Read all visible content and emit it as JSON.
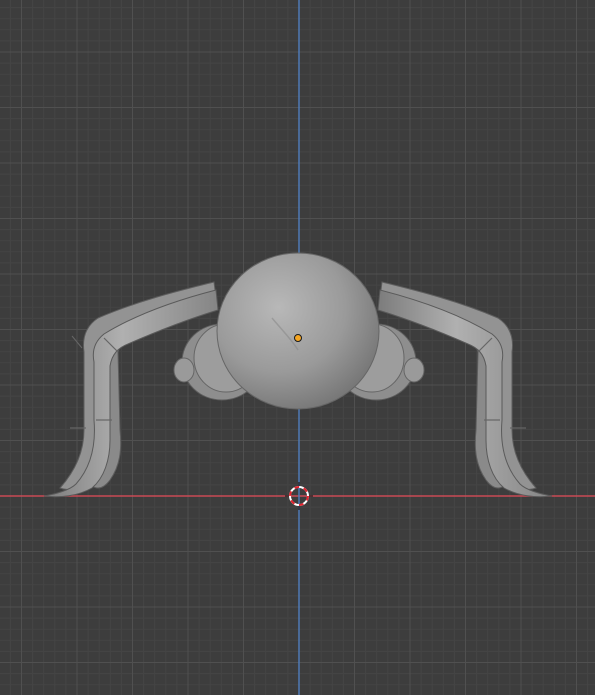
{
  "viewport": {
    "view": "front-orthographic",
    "background_color": "#3d3d3d",
    "grid_minor_color": "#454545",
    "grid_major_color": "#505050",
    "x_axis_color": "#c94a55",
    "z_axis_color": "#4e7ab5",
    "model_color": "#9c9c9c",
    "origin_color": "#f5a623",
    "cursor_colors": [
      "#e2232f",
      "#ffffff"
    ]
  },
  "scene": {
    "object": "spider-model"
  }
}
